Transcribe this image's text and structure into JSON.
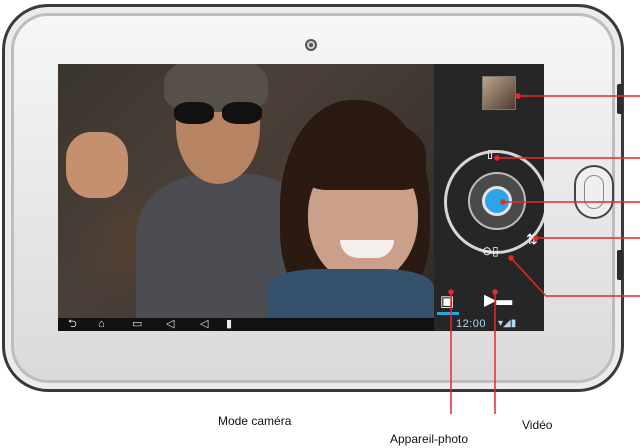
{
  "screen": {
    "clock": "12:00",
    "status": "▾◢▮"
  },
  "nav_bar": {
    "back_glyph": "⮌",
    "home_glyph": "⌂",
    "recent_glyph": "▭",
    "vol_down_glyph": "◁",
    "vol_up_glyph": "◁",
    "extra_glyph": "▮"
  },
  "camera_panel": {
    "settings_glyph": "⇅",
    "timer_glyph": "⊖▯",
    "camera_mode_glyph": "▣",
    "video_mode_glyph": "▶▬",
    "accent_color": "#2aa6e8"
  },
  "captions": {
    "mode_camera": "Mode caméra",
    "appareil_photo": "Appareil-photo",
    "video": "Vidéo"
  },
  "colors": {
    "callout_red": "#e32b2b"
  }
}
